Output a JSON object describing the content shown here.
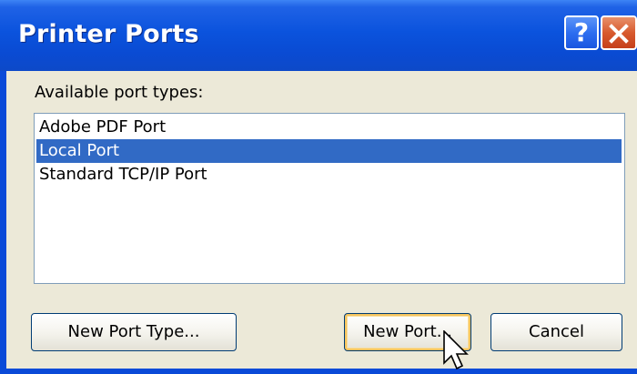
{
  "window": {
    "title": "Printer Ports",
    "help_glyph": "?",
    "close_icon": "close-icon"
  },
  "dialog": {
    "label": "Available port types:",
    "port_types": [
      "Adobe PDF Port",
      "Local Port",
      "Standard TCP/IP Port"
    ],
    "selected_index": 1
  },
  "buttons": {
    "new_port_type": "New Port Type...",
    "new_port": "New Port...",
    "cancel": "Cancel"
  },
  "colors": {
    "title_bar": "#0a4ad8",
    "selection": "#316ac5",
    "dialog_bg": "#ece9d8",
    "close_button": "#d85a2e"
  }
}
